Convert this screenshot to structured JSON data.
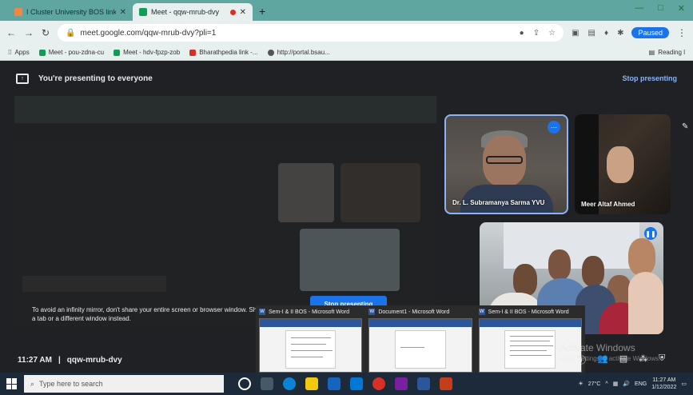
{
  "browser": {
    "tabs": [
      {
        "label": "I Cluster University BOS link - chro",
        "active": false
      },
      {
        "label": "Meet - qqw-mrub-dvy",
        "active": true,
        "recording": true
      }
    ],
    "new_tab": "+",
    "url": "meet.google.com/qqw-mrub-dvy?pli=1",
    "profile_status": "Paused",
    "bookmarks": [
      {
        "label": "Apps"
      },
      {
        "label": "Meet - pou-zdna-cu"
      },
      {
        "label": "Meet - hdv-fpzp-zob"
      },
      {
        "label": "Bharathpedia link -..."
      },
      {
        "label": "http://portal.bsau..."
      }
    ],
    "reading_list": "Reading l"
  },
  "meet": {
    "banner_text": "You're presenting to everyone",
    "stop_presenting_link": "Stop presenting",
    "participants": [
      {
        "name": "Dr. L. Subramanya Sarma YVU"
      },
      {
        "name": "Meer Altaf Ahmed"
      },
      {
        "name": ""
      }
    ],
    "warning": "To avoid an infinity mirror, don't share your entire screen or browser window. Share just a tab or a different window instead.",
    "stop_button": "Stop presenting",
    "time": "11:27 AM",
    "separator": "|",
    "meeting_code": "qqw-mrub-dvy"
  },
  "word_windows": [
    {
      "title": "Sem-I & II BOS - Microsoft Word"
    },
    {
      "title": "Document1 - Microsoft Word"
    },
    {
      "title": "Sem-I & II BOS - Microsoft Word"
    }
  ],
  "watermark": {
    "title": "Activate Windows",
    "subtitle": "Go to Settings to activate Windows."
  },
  "taskbar": {
    "search_placeholder": "Type here to search",
    "temperature": "27°C",
    "language": "ENG",
    "time": "11:27 AM",
    "date": "1/12/2022"
  },
  "colors": {
    "accent": "#1a73e8",
    "meet_bg": "#202124",
    "chrome_frame": "#5fa6a0"
  }
}
